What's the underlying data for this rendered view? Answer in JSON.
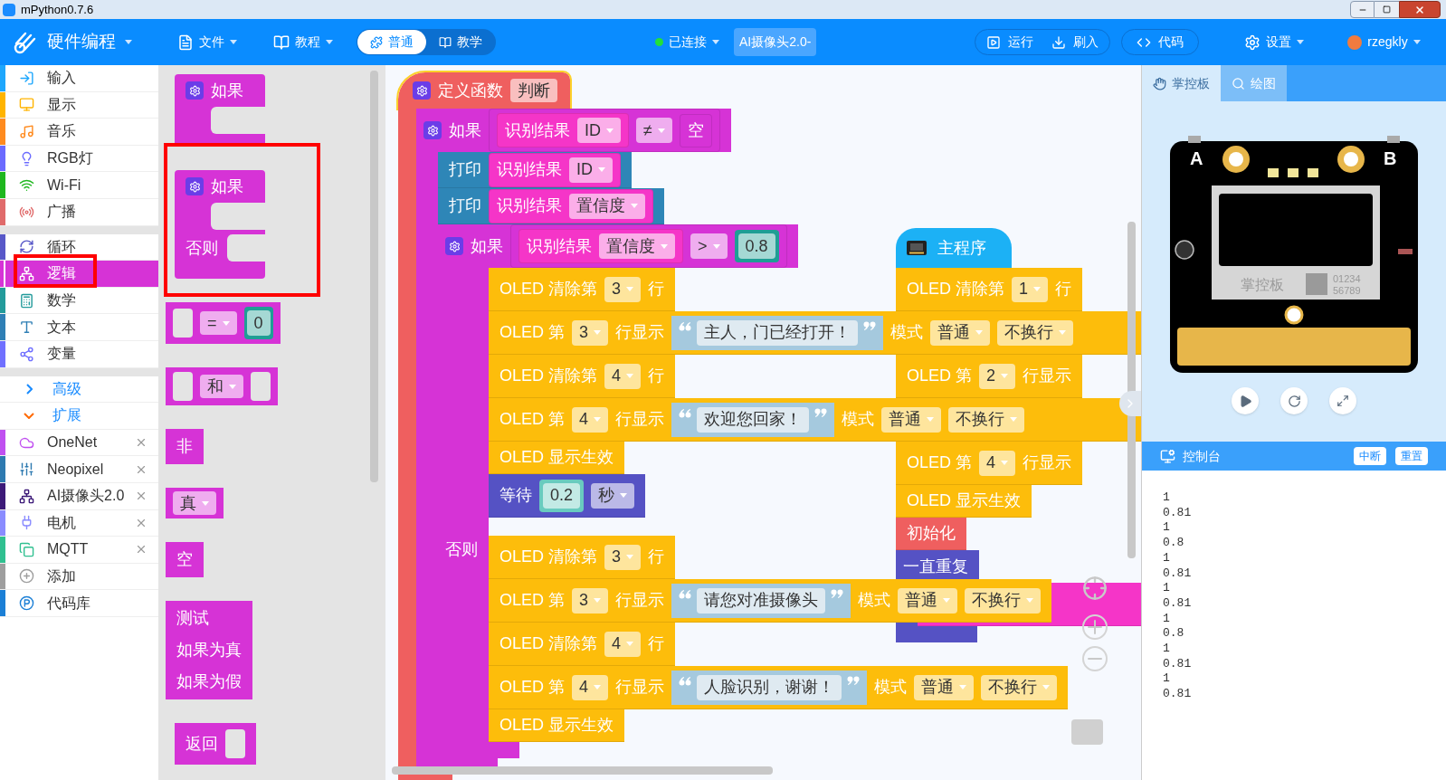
{
  "window": {
    "title": "mPython0.7.6"
  },
  "toolbar": {
    "app_menu": "硬件编程",
    "menus": [
      "文件",
      "教程"
    ],
    "modes": [
      {
        "label": "普通",
        "selected": true
      },
      {
        "label": "教学",
        "selected": false
      }
    ],
    "connection": {
      "label": "已连接",
      "connected": true
    },
    "device": "AI摄像头2.0-",
    "actions": [
      "运行",
      "刷入"
    ],
    "code": "代码",
    "settings": "设置",
    "user": "rzegkly"
  },
  "sidebar": {
    "groups": [
      [
        {
          "kind": "category",
          "label": "输入",
          "color": "#1ea7fd",
          "selected": false
        },
        {
          "kind": "category",
          "label": "显示",
          "color": "#ffb400",
          "selected": false
        },
        {
          "kind": "category",
          "label": "音乐",
          "color": "#ff8b1f",
          "selected": false
        },
        {
          "kind": "category",
          "label": "RGB灯",
          "color": "#6b6bff",
          "selected": false
        },
        {
          "kind": "category",
          "label": "Wi-Fi",
          "color": "#1fb71f",
          "selected": false
        },
        {
          "kind": "category",
          "label": "广播",
          "color": "#e06b6b",
          "selected": false
        }
      ],
      [
        {
          "kind": "category",
          "label": "循环",
          "color": "#5858c8",
          "selected": false
        },
        {
          "kind": "category",
          "label": "逻辑",
          "color": "#d633d6",
          "selected": true
        },
        {
          "kind": "category",
          "label": "数学",
          "color": "#239b9b",
          "selected": false
        },
        {
          "kind": "category",
          "label": "文本",
          "color": "#2f7fb5",
          "selected": false
        },
        {
          "kind": "category",
          "label": "变量",
          "color": "#7070ff",
          "selected": false
        }
      ],
      [
        {
          "kind": "toggle",
          "label": "高级",
          "expanded": false,
          "selected": false
        },
        {
          "kind": "toggle",
          "label": "扩展",
          "expanded": true,
          "selected": false
        },
        {
          "kind": "extension",
          "label": "OneNet",
          "color": "#c050f0",
          "selected": false
        },
        {
          "kind": "extension",
          "label": "Neopixel",
          "color": "#2e7ab0",
          "selected": false
        },
        {
          "kind": "extension",
          "label": "AI摄像头2.0",
          "color": "#3d1a78",
          "selected": false
        },
        {
          "kind": "extension",
          "label": "电机",
          "color": "#8a8cff",
          "selected": false
        },
        {
          "kind": "extension",
          "label": "MQTT",
          "color": "#30c090",
          "selected": false
        },
        {
          "kind": "category",
          "label": "添加",
          "color": "#9e9e9e",
          "selected": false
        },
        {
          "kind": "category",
          "label": "代码库",
          "color": "#1b7fd6",
          "selected": false
        }
      ]
    ]
  },
  "flyout": [
    {
      "kind": "if",
      "labels": [
        "如果"
      ]
    },
    {
      "kind": "if_else",
      "labels": [
        "如果",
        "否则"
      ]
    },
    {
      "kind": "compare",
      "op": "=",
      "value": "0"
    },
    {
      "kind": "operator",
      "op": "和"
    },
    {
      "kind": "label",
      "labels": [
        "非"
      ]
    },
    {
      "kind": "choice",
      "op": "真"
    },
    {
      "kind": "label",
      "labels": [
        "空"
      ]
    },
    {
      "kind": "label",
      "labels": [
        "测试",
        "如果为真",
        "如果为假"
      ]
    },
    {
      "kind": "return",
      "labels": [
        "返回"
      ]
    }
  ],
  "function_stack": {
    "kind": "function",
    "color": "#ef5f5f",
    "selected": true,
    "parts": [
      {
        "kind": "label",
        "text": "定义函数"
      },
      {
        "kind": "field",
        "text": "判断"
      }
    ],
    "body": [
      {
        "kind": "if",
        "color": "#d633d6",
        "parts": [
          {
            "kind": "label",
            "text": "如果"
          },
          {
            "kind": "reporter",
            "color": "#d633d6",
            "parts": [
              {
                "kind": "reporter",
                "color": "#f535c8",
                "parts": [
                  {
                    "kind": "label",
                    "text": "识别结果"
                  },
                  {
                    "kind": "dropdown",
                    "text": "ID"
                  }
                ]
              },
              {
                "kind": "dropdown",
                "text": "≠"
              },
              {
                "kind": "reporter",
                "color": "#d633d6",
                "parts": [
                  {
                    "kind": "label",
                    "text": "空"
                  }
                ]
              }
            ]
          }
        ],
        "body": [
          {
            "kind": "statement",
            "color": "#2e86b7",
            "parts": [
              {
                "kind": "label",
                "text": "打印"
              },
              {
                "kind": "reporter",
                "color": "#f535c8",
                "parts": [
                  {
                    "kind": "label",
                    "text": "识别结果"
                  },
                  {
                    "kind": "dropdown",
                    "text": "ID"
                  }
                ]
              }
            ]
          },
          {
            "kind": "statement",
            "color": "#2e86b7",
            "parts": [
              {
                "kind": "label",
                "text": "打印"
              },
              {
                "kind": "reporter",
                "color": "#f535c8",
                "parts": [
                  {
                    "kind": "label",
                    "text": "识别结果"
                  },
                  {
                    "kind": "dropdown",
                    "text": "置信度"
                  }
                ]
              }
            ]
          },
          {
            "kind": "if_else",
            "color": "#d633d6",
            "else_label": "否则",
            "parts": [
              {
                "kind": "label",
                "text": "如果"
              },
              {
                "kind": "reporter",
                "color": "#d633d6",
                "parts": [
                  {
                    "kind": "reporter",
                    "color": "#f535c8",
                    "parts": [
                      {
                        "kind": "label",
                        "text": "识别结果"
                      },
                      {
                        "kind": "dropdown",
                        "text": "置信度"
                      }
                    ]
                  },
                  {
                    "kind": "dropdown",
                    "text": ">"
                  },
                  {
                    "kind": "number",
                    "color": "#1f9e95",
                    "text": "0.8"
                  }
                ]
              }
            ],
            "body": [
              {
                "kind": "statement",
                "color": "#fdbd0b",
                "parts": [
                  {
                    "kind": "label",
                    "text": "OLED 清除第"
                  },
                  {
                    "kind": "dropdown",
                    "text": "3"
                  },
                  {
                    "kind": "label",
                    "text": "行"
                  }
                ]
              },
              {
                "kind": "statement",
                "color": "#fdbd0b",
                "parts": [
                  {
                    "kind": "label",
                    "text": "OLED 第"
                  },
                  {
                    "kind": "dropdown",
                    "text": "3"
                  },
                  {
                    "kind": "label",
                    "text": "行显示"
                  },
                  {
                    "kind": "string",
                    "text": "主人，门已经打开！"
                  },
                  {
                    "kind": "label",
                    "text": "模式"
                  },
                  {
                    "kind": "dropdown",
                    "text": "普通"
                  },
                  {
                    "kind": "dropdown",
                    "text": "不换行"
                  }
                ]
              },
              {
                "kind": "statement",
                "color": "#fdbd0b",
                "parts": [
                  {
                    "kind": "label",
                    "text": "OLED 清除第"
                  },
                  {
                    "kind": "dropdown",
                    "text": "4"
                  },
                  {
                    "kind": "label",
                    "text": "行"
                  }
                ]
              },
              {
                "kind": "statement",
                "color": "#fdbd0b",
                "parts": [
                  {
                    "kind": "label",
                    "text": "OLED 第"
                  },
                  {
                    "kind": "dropdown",
                    "text": "4"
                  },
                  {
                    "kind": "label",
                    "text": "行显示"
                  },
                  {
                    "kind": "string",
                    "text": "欢迎您回家！"
                  },
                  {
                    "kind": "label",
                    "text": "模式"
                  },
                  {
                    "kind": "dropdown",
                    "text": "普通"
                  },
                  {
                    "kind": "dropdown",
                    "text": "不换行"
                  }
                ]
              },
              {
                "kind": "statement",
                "color": "#fdbd0b",
                "parts": [
                  {
                    "kind": "label",
                    "text": "OLED 显示生效"
                  }
                ]
              },
              {
                "kind": "statement",
                "color": "#5552c4",
                "parts": [
                  {
                    "kind": "label",
                    "text": "等待"
                  },
                  {
                    "kind": "number",
                    "color": "#69cbbf",
                    "text": "0.2"
                  },
                  {
                    "kind": "dropdown",
                    "text": "秒"
                  }
                ]
              }
            ],
            "else": [
              {
                "kind": "statement",
                "color": "#fdbd0b",
                "parts": [
                  {
                    "kind": "label",
                    "text": "OLED 清除第"
                  },
                  {
                    "kind": "dropdown",
                    "text": "3"
                  },
                  {
                    "kind": "label",
                    "text": "行"
                  }
                ]
              },
              {
                "kind": "statement",
                "color": "#fdbd0b",
                "parts": [
                  {
                    "kind": "label",
                    "text": "OLED 第"
                  },
                  {
                    "kind": "dropdown",
                    "text": "3"
                  },
                  {
                    "kind": "label",
                    "text": "行显示"
                  },
                  {
                    "kind": "string",
                    "text": "请您对准摄像头"
                  },
                  {
                    "kind": "label",
                    "text": "模式"
                  },
                  {
                    "kind": "dropdown",
                    "text": "普通"
                  },
                  {
                    "kind": "dropdown",
                    "text": "不换行"
                  }
                ]
              },
              {
                "kind": "statement",
                "color": "#fdbd0b",
                "parts": [
                  {
                    "kind": "label",
                    "text": "OLED 清除第"
                  },
                  {
                    "kind": "dropdown",
                    "text": "4"
                  },
                  {
                    "kind": "label",
                    "text": "行"
                  }
                ]
              },
              {
                "kind": "statement",
                "color": "#fdbd0b",
                "parts": [
                  {
                    "kind": "label",
                    "text": "OLED 第"
                  },
                  {
                    "kind": "dropdown",
                    "text": "4"
                  },
                  {
                    "kind": "label",
                    "text": "行显示"
                  },
                  {
                    "kind": "string",
                    "text": "人脸识别，谢谢！"
                  },
                  {
                    "kind": "label",
                    "text": "模式"
                  },
                  {
                    "kind": "dropdown",
                    "text": "普通"
                  },
                  {
                    "kind": "dropdown",
                    "text": "不换行"
                  }
                ]
              },
              {
                "kind": "statement",
                "color": "#fdbd0b",
                "parts": [
                  {
                    "kind": "label",
                    "text": "OLED 显示生效"
                  }
                ]
              }
            ]
          }
        ]
      }
    ]
  },
  "main_stack": [
    {
      "kind": "hat",
      "color": "#1cb1f5",
      "parts": [
        {
          "kind": "label",
          "text": "主程序"
        }
      ]
    },
    {
      "kind": "statement",
      "color": "#fdbd0b",
      "parts": [
        {
          "kind": "label",
          "text": "OLED 清除第"
        },
        {
          "kind": "dropdown",
          "text": "1"
        },
        {
          "kind": "label",
          "text": "行"
        }
      ]
    },
    {
      "kind": "covered",
      "color": "#fdbd0b"
    },
    {
      "kind": "statement",
      "color": "#fdbd0b",
      "parts": [
        {
          "kind": "label",
          "text": "OLED 第"
        },
        {
          "kind": "dropdown",
          "text": "2"
        },
        {
          "kind": "label",
          "text": "行显示"
        }
      ]
    },
    {
      "kind": "covered",
      "color": "#fdbd0b"
    },
    {
      "kind": "statement",
      "color": "#fdbd0b",
      "parts": [
        {
          "kind": "label",
          "text": "OLED 第"
        },
        {
          "kind": "dropdown",
          "text": "4"
        },
        {
          "kind": "label",
          "text": "行显示"
        }
      ]
    },
    {
      "kind": "statement",
      "color": "#fdbd0b",
      "parts": [
        {
          "kind": "label",
          "text": "OLED 显示生效"
        }
      ]
    },
    {
      "kind": "statement",
      "color": "#ef5f5f",
      "parts": [
        {
          "kind": "label",
          "text": "初始化"
        }
      ]
    },
    {
      "kind": "loop",
      "color": "#5552c4",
      "parts": [
        {
          "kind": "label",
          "text": "一直重复"
        }
      ],
      "body": [
        {
          "kind": "covered",
          "color": "#f535c8"
        }
      ]
    }
  ],
  "panel": {
    "tabs": [
      {
        "label": "掌控板",
        "selected": true
      },
      {
        "label": "绘图",
        "selected": false
      }
    ],
    "board": {
      "button_labels": [
        "A",
        "B"
      ],
      "screen_logo": "掌控板",
      "screen_digits": [
        "01234",
        "56789"
      ]
    },
    "console": {
      "title": "控制台",
      "buttons": [
        "中断",
        "重置"
      ],
      "lines": [
        "1",
        "0.81",
        "1",
        "0.8",
        "1",
        "0.81",
        "1",
        "0.81",
        "1",
        "0.8",
        "1",
        "0.81",
        "1",
        "0.81"
      ]
    }
  }
}
